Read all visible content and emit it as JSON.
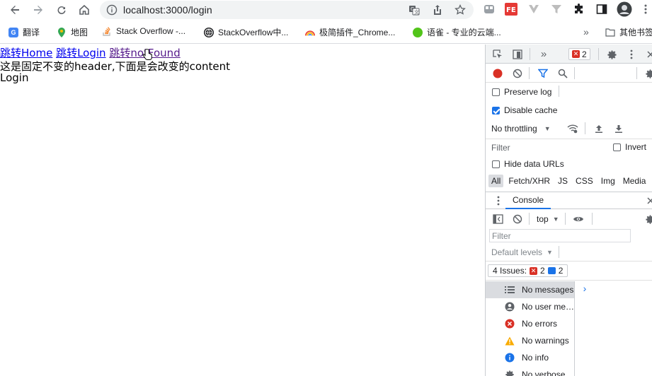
{
  "browser": {
    "url": "localhost:3000/login"
  },
  "bookmarks": [
    {
      "label": "翻译"
    },
    {
      "label": "地图"
    },
    {
      "label": "Stack Overflow -..."
    },
    {
      "label": "StackOverflow中..."
    },
    {
      "label": "极简插件_Chrome..."
    },
    {
      "label": "语雀 - 专业的云端..."
    },
    {
      "label": "其他书签"
    }
  ],
  "page": {
    "links": [
      {
        "label": "跳转Home"
      },
      {
        "label": "跳转Login"
      },
      {
        "label": "跳转notFound"
      }
    ],
    "header_text": "这是固定不变的header,下面是会改变的content",
    "content_text": "Login"
  },
  "devtools": {
    "error_count": "2",
    "network": {
      "preserve_log": "Preserve log",
      "disable_cache": "Disable cache",
      "throttling": "No throttling",
      "filter_label": "Filter",
      "invert": "Invert",
      "hide_data_urls": "Hide data URLs",
      "type_filters": [
        "All",
        "Fetch/XHR",
        "JS",
        "CSS",
        "Img",
        "Media"
      ]
    },
    "console": {
      "tab_label": "Console",
      "context": "top",
      "filter_placeholder": "Filter",
      "default_levels": "Default levels",
      "issues_label": "4 Issues:",
      "issues_errors": "2",
      "issues_messages": "2",
      "sidebar": [
        {
          "label": "No messages",
          "icon": "list-icon"
        },
        {
          "label": "No user me…",
          "icon": "user-icon"
        },
        {
          "label": "No errors",
          "icon": "error-icon"
        },
        {
          "label": "No warnings",
          "icon": "warning-icon"
        },
        {
          "label": "No info",
          "icon": "info-icon"
        },
        {
          "label": "No verbose",
          "icon": "verbose-icon"
        }
      ]
    }
  }
}
